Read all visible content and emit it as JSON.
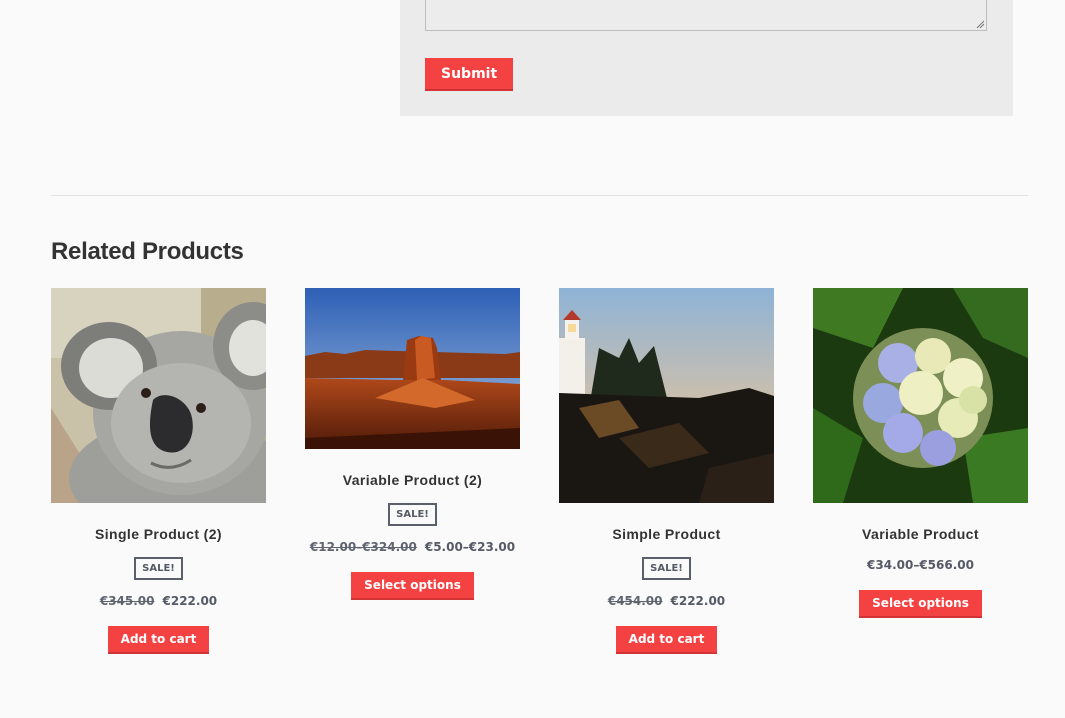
{
  "form": {
    "submit_label": "Submit"
  },
  "related": {
    "title": "Related Products",
    "products": [
      {
        "name": "Single Product (2)",
        "badge": "SALE!",
        "old_price": "€345.00",
        "price": "€222.00",
        "button": "Add to cart",
        "image": "koala"
      },
      {
        "name": "Variable Product (2)",
        "badge": "SALE!",
        "old_price": "€12.00–€324.00",
        "price": "€5.00–€23.00",
        "button": "Select options",
        "image": "desert-butte"
      },
      {
        "name": "Simple Product",
        "badge": "SALE!",
        "old_price": "€454.00",
        "price": "€222.00",
        "button": "Add to cart",
        "image": "lighthouse"
      },
      {
        "name": "Variable Product",
        "price": "€34.00–€566.00",
        "button": "Select options",
        "image": "hydrangea"
      }
    ]
  },
  "colors": {
    "accent": "#f44243",
    "badge_border": "#5b5f6b",
    "background": "#fafafa"
  }
}
